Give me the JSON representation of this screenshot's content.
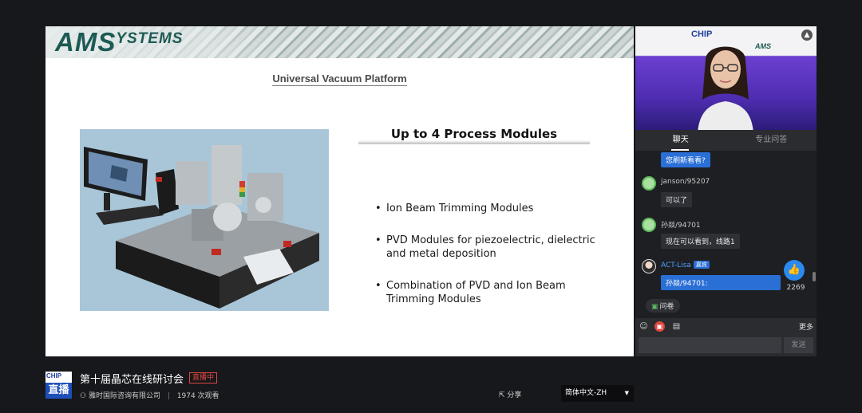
{
  "slide": {
    "logo_big": "AMS",
    "logo_small": "YSTEMS",
    "title": "Universal Vacuum Platform",
    "modules_heading": "Up to 4 Process Modules",
    "bullets": [
      "Ion Beam Trimming Modules",
      "PVD Modules for piezoelectric, dielectric and metal deposition",
      "Combination of PVD and Ion Beam Trimming Modules"
    ]
  },
  "video": {
    "chip_text": "CHIP",
    "ams_text": "AMS"
  },
  "tabs": [
    "聊天",
    "专业问答"
  ],
  "chat": {
    "messages": [
      {
        "user": "",
        "text": "您刷新看看?",
        "highlight": true
      },
      {
        "user": "janson/95207",
        "text": "可以了",
        "highlight": false
      },
      {
        "user": "孙燚/94701",
        "text": "现在可以看到，线路1",
        "highlight": false
      },
      {
        "user": "ACT-Lisa",
        "badge": "嘉宾",
        "text": "孙燚/94701:",
        "highlight": true
      }
    ],
    "like_count": "2269",
    "survey_label": "问卷",
    "more_label": "更多",
    "input_value": "",
    "send_label": "发送"
  },
  "footer": {
    "chip_logo": "CHIP",
    "live_logo": "直播",
    "event_title": "第十届晶芯在线研讨会",
    "live_status": "直播中",
    "organizer": "雅时国际咨询有限公司",
    "separator": "|",
    "viewers": "1974 次观看",
    "share_label": "分享",
    "language": "简体中文-ZH"
  },
  "icons": {
    "user_icon": "person-outline",
    "share_icon": "share-arrow",
    "emoji_icon": "smiley",
    "gift_icon": "gift",
    "note_icon": "document",
    "like_icon": "thumbs-up",
    "collapse_icon": "chevron-up"
  },
  "colors": {
    "accent_blue": "#2a6fd6",
    "live_red": "#e0473f",
    "logo_green": "#1d5a54"
  }
}
